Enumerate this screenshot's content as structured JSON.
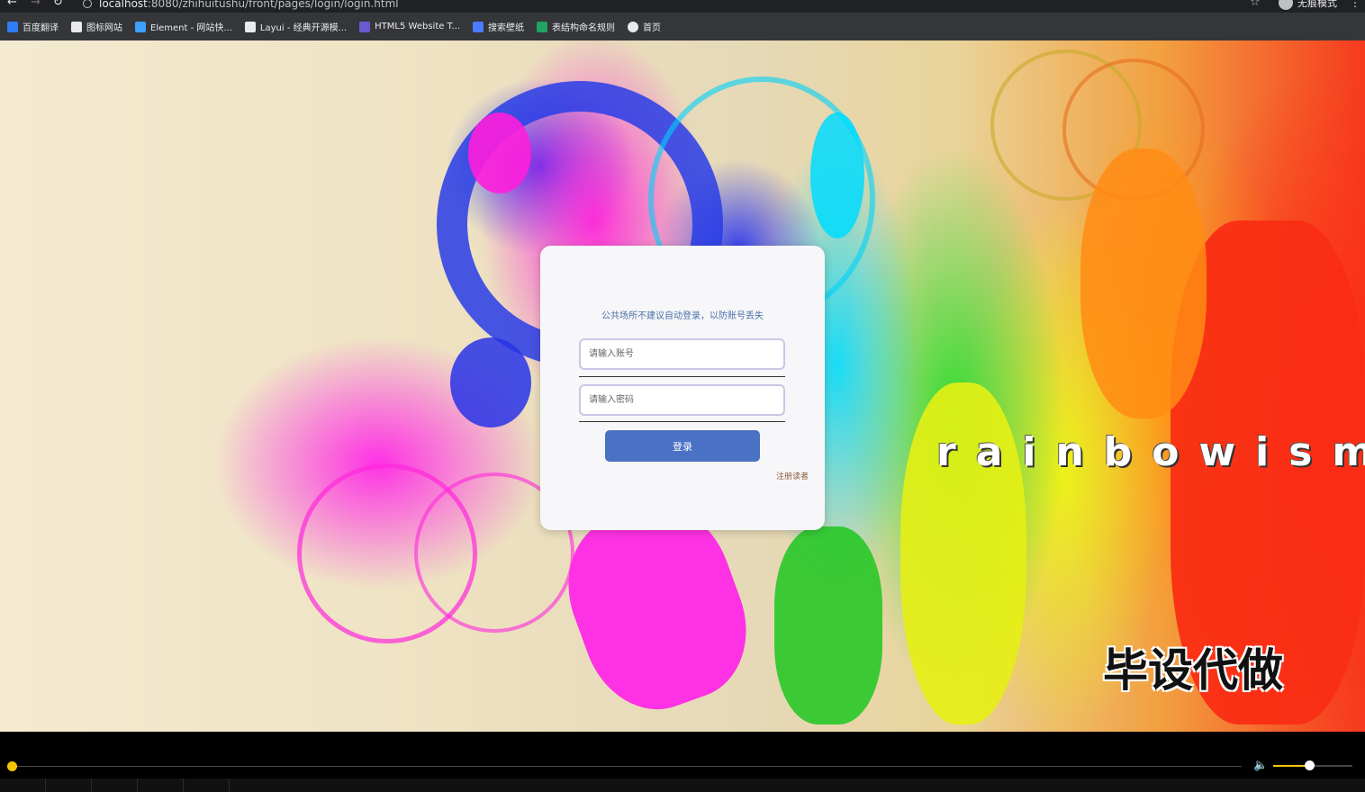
{
  "browser": {
    "url_host": "localhost",
    "url_path": ":8080/zhihuitushu/front/pages/login/login.html",
    "incognito_label": "无痕模式",
    "bookmarks": [
      {
        "label": "百度翻译",
        "icon": "baidu-translate-icon",
        "color": "#2e7cf6"
      },
      {
        "label": "图标网站",
        "icon": "icon-site-icon",
        "color": "#e8eaed"
      },
      {
        "label": "Element - 网站快...",
        "icon": "element-icon",
        "color": "#409eff"
      },
      {
        "label": "Layui - 经典开源模...",
        "icon": "layui-icon",
        "color": "#e8eaed"
      },
      {
        "label": "HTML5 Website T...",
        "icon": "html5-icon",
        "color": "#6a5acd"
      },
      {
        "label": "搜索壁纸",
        "icon": "wallpaper-icon",
        "color": "#4a7cff"
      },
      {
        "label": "表结构命名规则",
        "icon": "table-naming-icon",
        "color": "#1fa463"
      },
      {
        "label": "首页",
        "icon": "globe-icon",
        "color": "#e8eaed"
      }
    ]
  },
  "background": {
    "brand_text": "rainbowism",
    "watermark": "毕设代做"
  },
  "login": {
    "notice": "公共场所不建议自动登录，以防账号丢失",
    "account_placeholder": "请输入账号",
    "password_placeholder": "请输入密码",
    "login_label": "登录",
    "register_label": "注册读者",
    "button_color": "#4a72c4"
  },
  "player": {
    "progress_fraction": 0.0,
    "volume_fraction": 0.45,
    "accent_color": "#f5c400"
  }
}
